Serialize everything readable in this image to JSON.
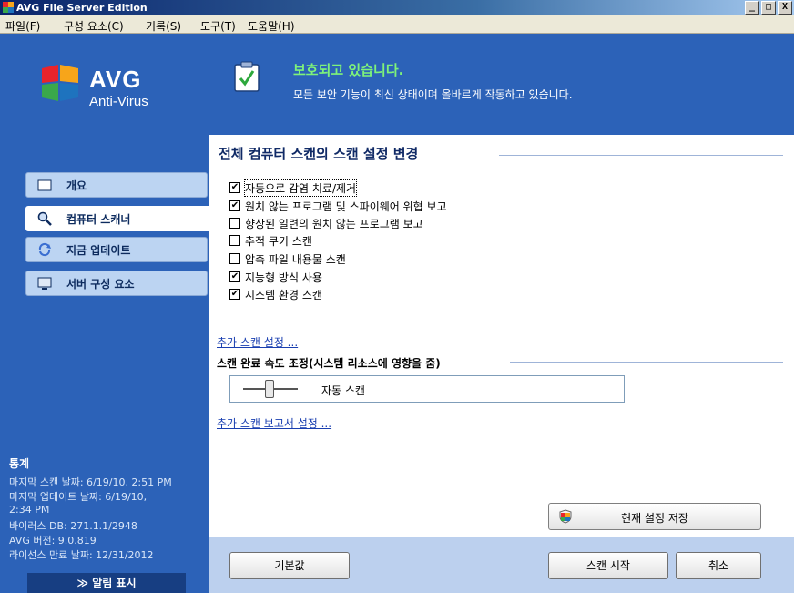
{
  "window": {
    "title": "AVG File Server Edition",
    "btn_min": "_",
    "btn_max": "□",
    "btn_close": "X"
  },
  "menu": {
    "items": [
      "파일(F)",
      "구성 요소(C)",
      "기록(S)",
      "도구(T)",
      "도움말(H)"
    ]
  },
  "logo": {
    "brand": "AVG",
    "product": "Anti-Virus"
  },
  "status": {
    "title": "보호되고 있습니다.",
    "description": "모든 보안 기능이 최신 상태이며 올바르게 작동하고 있습니다."
  },
  "sidebar": {
    "items": [
      {
        "label": "개요",
        "icon": "folder-icon"
      },
      {
        "label": "컴퓨터 스캐너",
        "icon": "magnifier-icon"
      },
      {
        "label": "지금 업데이트",
        "icon": "update-icon"
      },
      {
        "label": "서버 구성 요소",
        "icon": "server-icon"
      }
    ],
    "stats": {
      "title": "통계",
      "lines": [
        "마지막 스캔 날짜: 6/19/10, 2:51 PM",
        "마지막 업데이트 날짜: 6/19/10,",
        "2:34 PM",
        "바이러스 DB: 271.1.1/2948",
        "AVG 버전:    9.0.819",
        "라이선스 만료 날짜: 12/31/2012"
      ]
    },
    "alert_button": "≫ 알림 표시"
  },
  "main": {
    "title": "전체 컴퓨터 스캔의 스캔 설정 변경",
    "options": [
      {
        "label": "자동으로 감염 치료/제거",
        "checked": true
      },
      {
        "label": "원치 않는 프로그램 및 스파이웨어 위협 보고",
        "checked": true
      },
      {
        "label": "향상된 일련의 원치 않는 프로그램 보고",
        "checked": false
      },
      {
        "label": "추적 쿠키 스캔",
        "checked": false
      },
      {
        "label": "압축 파일 내용물 스캔",
        "checked": false
      },
      {
        "label": "지능형 방식 사용",
        "checked": true
      },
      {
        "label": "시스템 환경 스캔",
        "checked": true
      }
    ],
    "additional_settings_link": "추가 스캔 설정 ...",
    "speed_title": "스캔 완료 속도 조정(시스템 리소스에 영향을 줌)",
    "speed_value": "자동 스캔",
    "report_settings_link": "추가 스캔 보고서 설정 ...",
    "save_button": "현재 설정 저장"
  },
  "bottom": {
    "default_button": "기본값",
    "start_button": "스캔 시작",
    "cancel_button": "취소"
  },
  "colors": {
    "frame": "#2c62b8",
    "status_title": "#7ef27a",
    "link": "#1a3fb0"
  }
}
